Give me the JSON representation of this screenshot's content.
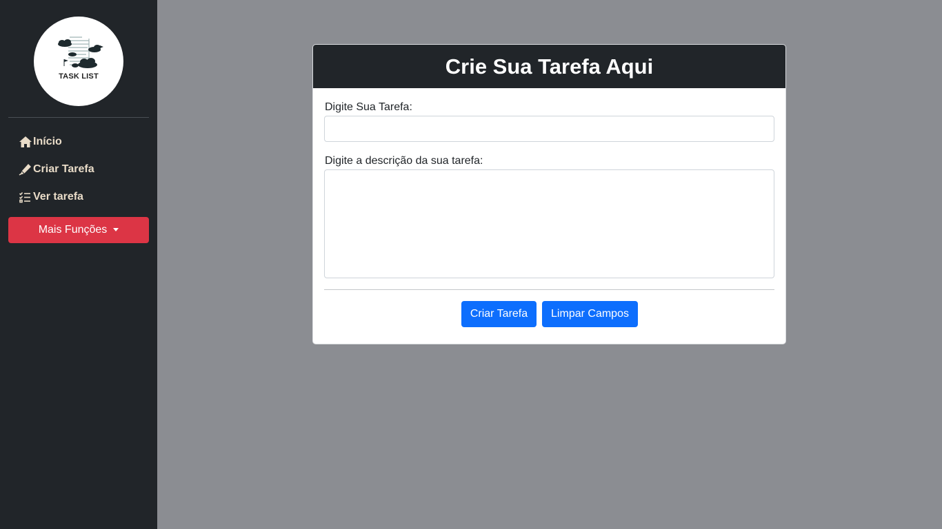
{
  "sidebar": {
    "logo": {
      "text": "TASK LIST"
    },
    "nav": [
      {
        "label": "Início",
        "icon": "home-icon"
      },
      {
        "label": "Criar Tarefa",
        "icon": "pen-icon"
      },
      {
        "label": "Ver tarefa",
        "icon": "list-check-icon"
      }
    ],
    "more_button": {
      "label": "Mais Funções",
      "icon": "caret-down-icon"
    }
  },
  "form": {
    "title": "Crie Sua Tarefa Aqui",
    "task_label": "Digite Sua Tarefa:",
    "task_value": "",
    "description_label": "Digite a descrição da sua tarefa:",
    "description_value": "",
    "create_button": "Criar Tarefa",
    "clear_button": "Limpar Campos"
  },
  "colors": {
    "sidebar_bg": "#212529",
    "page_bg": "#8b8d92",
    "nav_text": "#e9dcc8",
    "danger": "#dc3545",
    "primary": "#0d6efd"
  }
}
